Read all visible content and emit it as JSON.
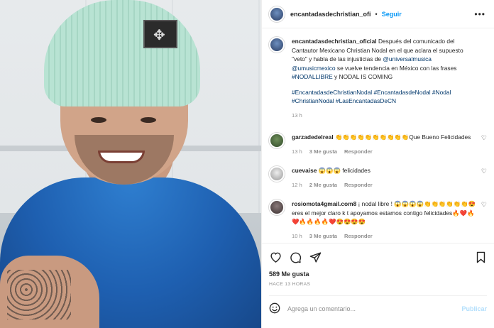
{
  "header": {
    "username": "encantadasdechristian_ofi",
    "separator": "•",
    "follow_label": "Seguir",
    "more_icon": "more-dots-icon"
  },
  "caption": {
    "username": "encantadasdechristian_oficial",
    "text_1": " Después del comunicado del Cantautor Mexicano Christian Nodal en el que aclara el supuesto \"veto\" y habla de las injusticias de ",
    "mention_1": "@universalmusica",
    "mention_2": "@umusicmexico",
    "text_2": " se vuelve tendencia en México con las frases ",
    "hashtag_1": "#NODALLIBRE",
    "text_3": " y NODAL IS COMING",
    "hashtags": "#EncantadasdeChristianNodal #EncantadasdeNodal #Nodal #ChristianNodal #LasEncantadasDeCN",
    "time": "13 h"
  },
  "comments": [
    {
      "username": "garzadedelreal",
      "text": " 👏👏👏👏👏👏👏👏👏👏Que Bueno Felicidades",
      "time": "13 h",
      "likes": "3 Me gusta",
      "reply": "Responder"
    },
    {
      "username": "cuevaise",
      "text": " 😱😱😱 felicidades",
      "time": "12 h",
      "likes": "2 Me gusta",
      "reply": "Responder"
    },
    {
      "username": "rosiomota4gmail.com8",
      "text": " ¡ nodal libre ! 😱😱😱😱👏👏👏👏👏👏😍eres el mejor claro k t apoyamos estamos contigo felicidades🔥❤️🔥❤️🔥🔥🔥🔥❤️😍😍😍😍",
      "time": "10 h",
      "likes": "3 Me gusta",
      "reply": "Responder"
    }
  ],
  "actions": {
    "likes": "589 Me gusta",
    "time": "HACE 13 HORAS",
    "comment_placeholder": "Agrega un comentario...",
    "publish_label": "Publicar"
  }
}
